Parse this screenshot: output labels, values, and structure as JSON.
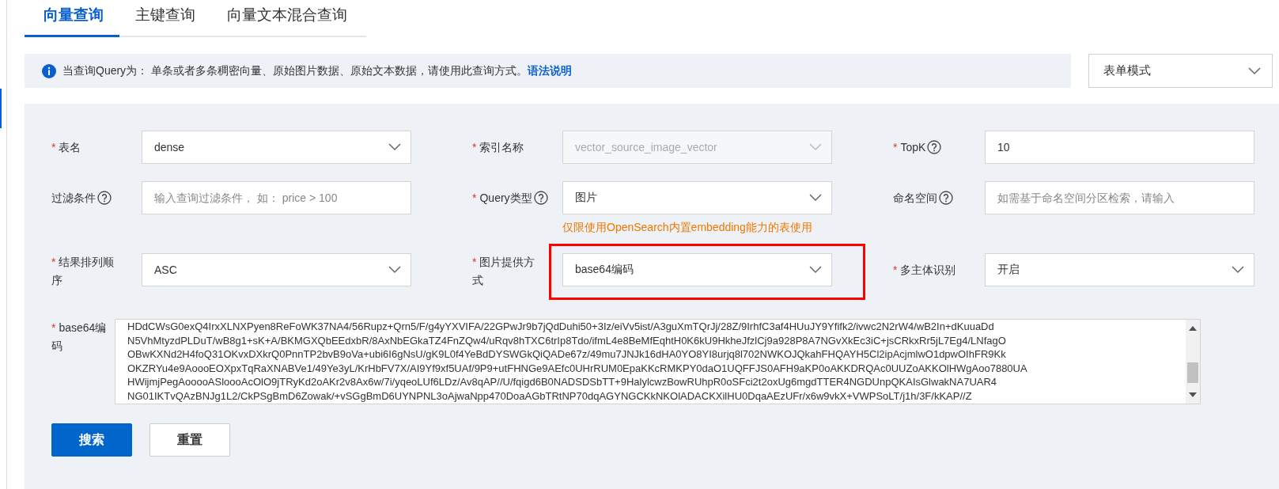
{
  "tabs": [
    {
      "label": "向量查询",
      "selected": true
    },
    {
      "label": "主键查询",
      "selected": false
    },
    {
      "label": "向量文本混合查询",
      "selected": false
    }
  ],
  "notice": {
    "text": "当查询Query为： 单条或者多条稠密向量、原始图片数据、原始文本数据，请使用此查询方式。",
    "link": "语法说明"
  },
  "mode_select": {
    "value": "表单模式"
  },
  "form": {
    "fields": [
      {
        "kind": "select",
        "required_mark": "*",
        "label": "表名",
        "value": "dense"
      },
      {
        "kind": "select",
        "required_mark": "*",
        "label": "索引名称",
        "value": "vector_source_image_vector",
        "disabled": true
      },
      {
        "kind": "input",
        "required_mark": "*",
        "label": "TopK",
        "help": true,
        "value": "10"
      },
      {
        "kind": "input",
        "label": "过滤条件",
        "help": true,
        "placeholder": "输入查询过滤条件， 如： price > 100"
      },
      {
        "kind": "select",
        "required_mark": "*",
        "label": "Query类型",
        "help": true,
        "value": "图片",
        "hint": "仅限使用OpenSearch内置embedding能力的表使用"
      },
      {
        "kind": "input",
        "label": "命名空间",
        "help": true,
        "placeholder": "如需基于命名空间分区检索，请输入"
      },
      {
        "kind": "select",
        "required_mark": "*",
        "label": "结果排列顺序",
        "value": "ASC"
      },
      {
        "kind": "select",
        "required_mark": "*",
        "label": "图片提供方式",
        "value": "base64编码",
        "highlighted": true
      },
      {
        "kind": "select",
        "required_mark": "*",
        "label": "多主体识别",
        "value": "开启"
      }
    ],
    "base64": {
      "required_mark": "*",
      "label": "base64编码",
      "lines": [
        "HDdCWsG0exQ4IrxXLNXPyen8ReFoWK37NA4/56Rupz+Qrn5/F/g4yYXVIFA/22GPwJr9b7jQdDuhi50+3Iz/eiVv5ist/A3guXmTQrJj/28Z/9IrhfC3af4HUuJY9Yfifk2/ivwc2N2rW4/wB2In+dKuuaDd",
        "N5VhMtyzdPLDuT/wB8g1+sK+A/BKMGXQbEEdxbR/8AxNbEGkaTZ4FnZQw4/uRqv8hTXC6trIp8Tdo/ifmL4e8BeMfEqhtH0K6kU9HkheJfzlCj9a928P8A7NGvXkEc3iC+jsCRkxRr5jL7Eg4/LNfagO",
        "OBwKXNd2H4foQ31OKvxDXkrQ0PnnTP2bvB9oVa+ubi6I6gNsU/gK9L0f4YeBdDYSWGkQiQADe67z/49mu7JNJk16dHA0YO8YI8urjq8l702NWKOJQkahFHQAYH5Cl2ipAcjmlwO1dpwOIhFR9Kk",
        "OKZRYu4e9AoooEOXpxTqRaXNABVe1/49Ye3yL/KrHbFV7X/AI9Yf9xf5UAf/9P9+utFHNGe9AEfc0UHrRUM0EpaKKcRMKPY0daO1UQFFJS0AFH9aKP0oAKKDRQAc0UUZoAKKOlHWgAoo7880UA",
        "HWijmjPegAooooASloooAcOlO9jTRyKd2oAKr2v8Ax6w/7i/yqeoLUf6LDz/Av8qAP//U/fqigd6B0NADSDSbTT+9HalylcwzBowRUhpR0oSFci2t2oxUg6mgdTTER4NGDUnpQKAIsGlwakNA7UAR4",
        "NG01IKTvQAzBNJg1L2/CkPSgBmD6Zowak/+vSGgBmD6UYNPNL3oAjwaNpp470DoaAGbTRtNP70dqAGYNGCKkNKOlADACKXilHU0DqaAEzUFr/x6w9vkX+VWPSoLT/j1h/3F/kKAP//Z"
      ]
    },
    "buttons": [
      {
        "label": "搜索",
        "kind": "primary"
      },
      {
        "label": "重置",
        "kind": "default"
      }
    ]
  }
}
